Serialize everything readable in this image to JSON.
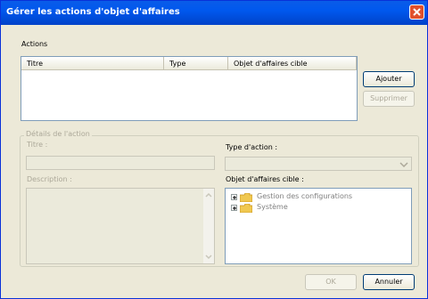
{
  "window": {
    "title": "Gérer les actions d'objet d'affaires"
  },
  "actions": {
    "label": "Actions",
    "columns": [
      "Titre",
      "Type",
      "Objet d'affaires cible"
    ],
    "rows": []
  },
  "buttons": {
    "add": "Ajouter",
    "remove": "Supprimer",
    "ok": "OK",
    "cancel": "Annuler"
  },
  "details": {
    "group_title": "Détails de l'action",
    "title_label": "Titre :",
    "title_value": "",
    "type_label": "Type d'action :",
    "type_value": "",
    "description_label": "Description :",
    "description_value": "",
    "target_label": "Objet d'affaires cible :",
    "tree": [
      "Gestion des configurations",
      "Système"
    ]
  },
  "colors": {
    "titlebar": "#0058ee",
    "close": "#e0502c",
    "background": "#ece9d8"
  }
}
